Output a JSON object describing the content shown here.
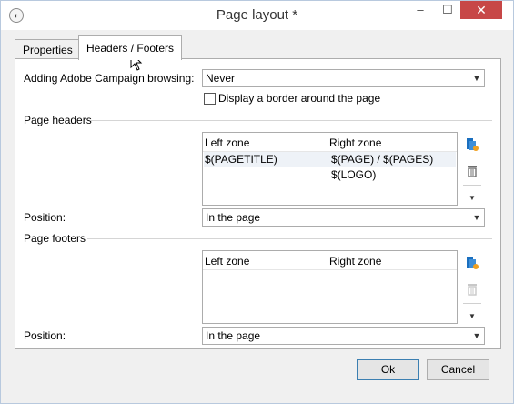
{
  "window": {
    "title": "Page layout *",
    "minimize": "–",
    "maximize": "☐",
    "close": "✕"
  },
  "tabs": [
    {
      "label": "Properties"
    },
    {
      "label": "Headers / Footers"
    }
  ],
  "form": {
    "browsing_label": "Adding Adobe Campaign browsing:",
    "browsing_value": "Never",
    "border_checkbox_label": "Display a border around the page",
    "border_checked": false
  },
  "headers": {
    "section_label": "Page headers",
    "columns": [
      "Left zone",
      "Right zone"
    ],
    "rows": [
      {
        "left": "$(PAGETITLE)",
        "right": "$(PAGE) / $(PAGES)"
      },
      {
        "left": "",
        "right": "$(LOGO)"
      }
    ],
    "position_label": "Position:",
    "position_value": "In the page"
  },
  "footers": {
    "section_label": "Page footers",
    "columns": [
      "Left zone",
      "Right zone"
    ],
    "rows": [],
    "position_label": "Position:",
    "position_value": "In the page"
  },
  "buttons": {
    "ok": "Ok",
    "cancel": "Cancel"
  },
  "colors": {
    "close_button": "#c74747",
    "selection": "#eef2f7",
    "add_icon": "#1a6fbf",
    "add_badge": "#f0a020"
  }
}
